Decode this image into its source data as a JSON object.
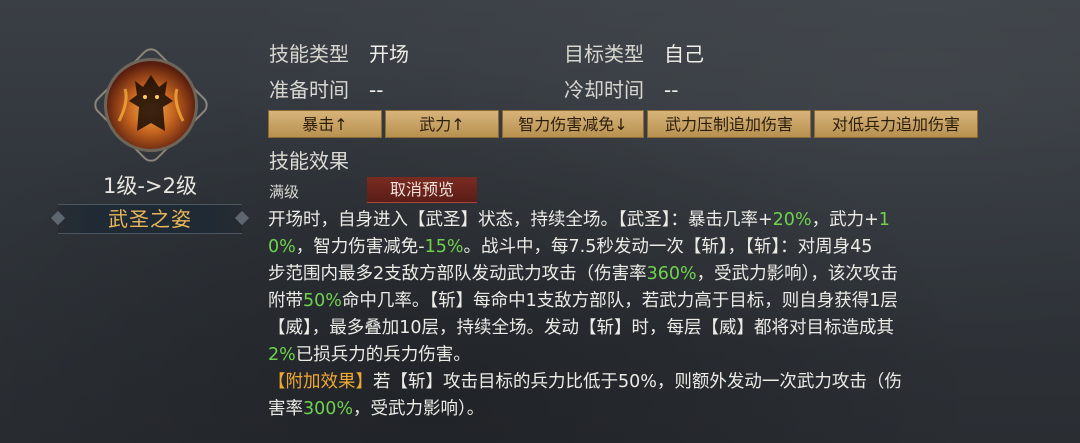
{
  "skill": {
    "level_text": "1级->2级",
    "name": "武圣之姿"
  },
  "info": {
    "type_label": "技能类型",
    "type_value": "开场",
    "target_label": "目标类型",
    "target_value": "自己",
    "prep_label": "准备时间",
    "prep_value": "--",
    "cooldown_label": "冷却时间",
    "cooldown_value": "--"
  },
  "tags": [
    "暴击↑",
    "武力↑",
    "智力伤害减免↓",
    "武力压制追加伤害",
    "对低兵力追加伤害"
  ],
  "effect_title": "技能效果",
  "max_level_label": "满级",
  "cancel_preview_label": "取消预览",
  "description": {
    "l1a": "开场时，自身进入【武圣】状态，持续全场。【武圣】：暴击几率+",
    "l1b": "20%",
    "l1c": "，武力+",
    "l1d": "1",
    "l2a": "0%",
    "l2b": "，智力伤害减免-",
    "l2c": "15%",
    "l2d": "。战斗中，每7.5秒发动一次【斩】，【斩】：对周身45",
    "l3a": "步范围内最多2支敌方部队发动武力攻击（伤害率",
    "l3b": "360%",
    "l3c": "，受武力影响），该次攻击",
    "l4a": "附带",
    "l4b": "50%",
    "l4c": "命中几率。【斩】每命中1支敌方部队，若武力高于目标，则自身获得1层",
    "l5": "【威】，最多叠加10层，持续全场。发动【斩】时，每层【威】都将对目标造成其",
    "l6a": "2%",
    "l6b": "已损兵力的兵力伤害。",
    "l7a": "【附加效果】",
    "l7b": "若【斩】攻击目标的兵力比低于50%，则额外发动一次武力攻击（伤",
    "l8a": "害率",
    "l8b": "300%",
    "l8c": "，受武力影响）。"
  }
}
